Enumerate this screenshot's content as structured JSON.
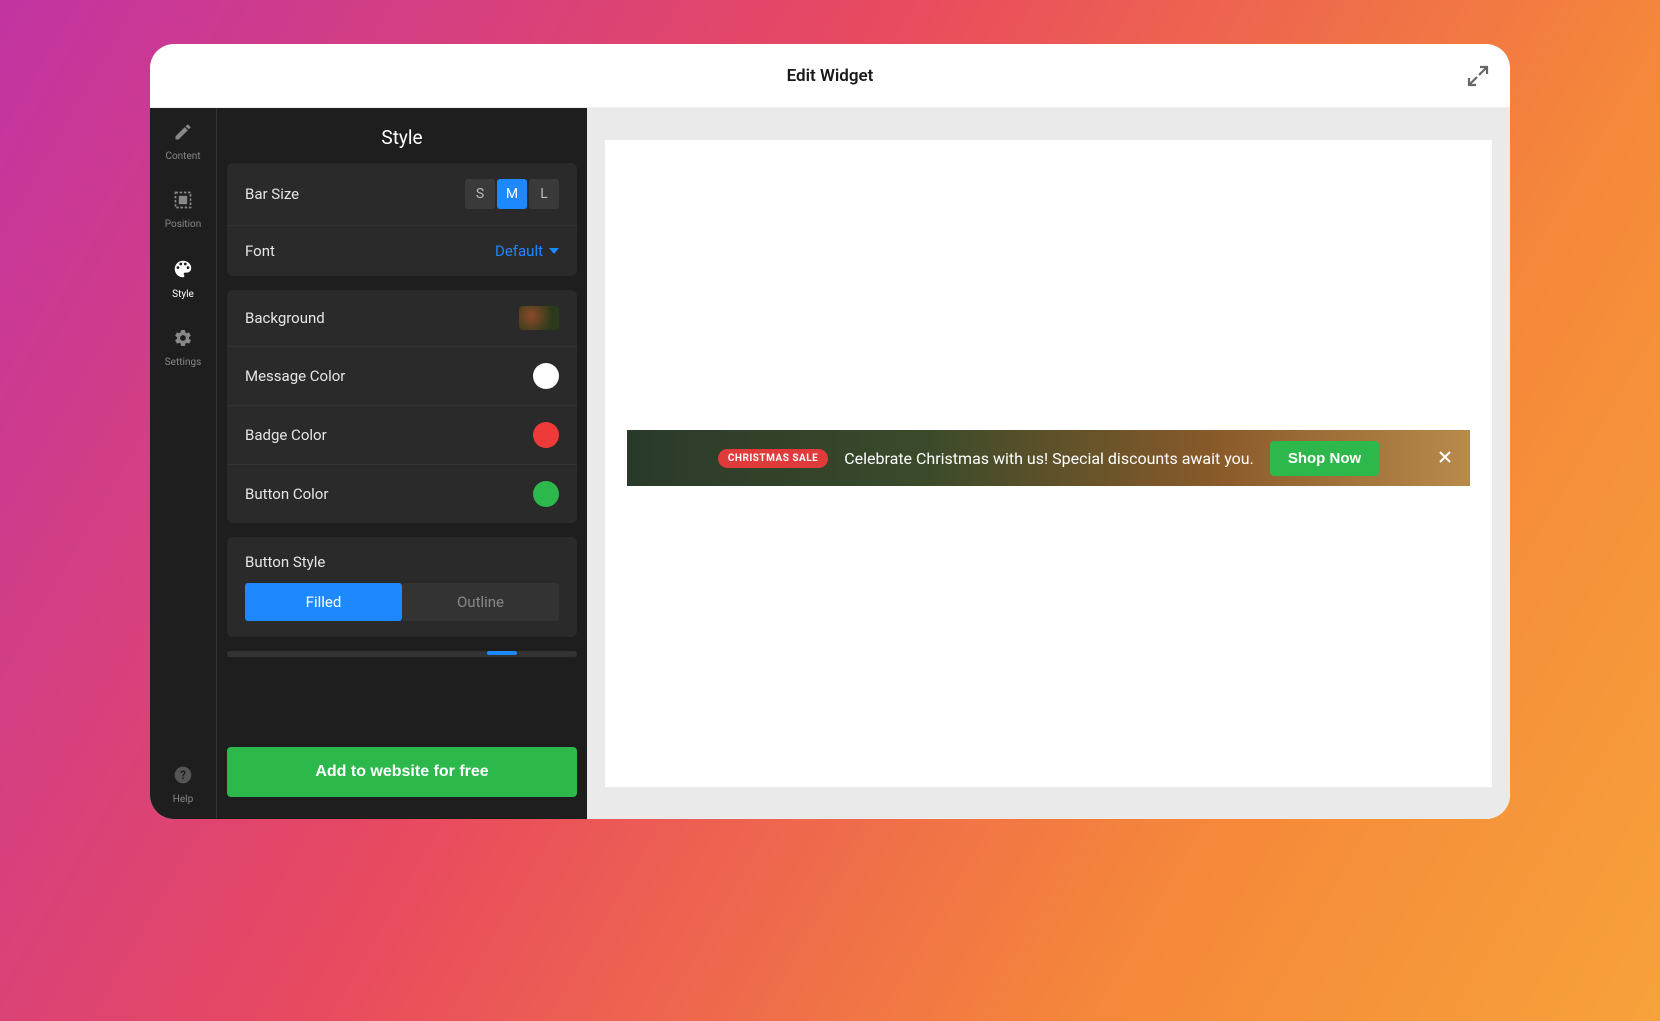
{
  "modal": {
    "title": "Edit Widget"
  },
  "nav": {
    "items": [
      {
        "label": "Content"
      },
      {
        "label": "Position"
      },
      {
        "label": "Style"
      },
      {
        "label": "Settings"
      }
    ],
    "help_label": "Help"
  },
  "panel": {
    "title": "Style",
    "bar_size": {
      "label": "Bar Size",
      "options": [
        "S",
        "M",
        "L"
      ],
      "selected": "M"
    },
    "font": {
      "label": "Font",
      "value": "Default"
    },
    "background_label": "Background",
    "message_color": {
      "label": "Message Color",
      "value": "#ffffff"
    },
    "badge_color": {
      "label": "Badge Color",
      "value": "#ef3a3a"
    },
    "button_color": {
      "label": "Button Color",
      "value": "#2db84c"
    },
    "button_style": {
      "label": "Button Style",
      "options": [
        "Filled",
        "Outline"
      ],
      "selected": "Filled"
    },
    "add_button": "Add to website for free"
  },
  "preview": {
    "badge_text": "CHRISTMAS SALE",
    "message": "Celebrate Christmas with us! Special discounts await you.",
    "button_text": "Shop Now"
  }
}
